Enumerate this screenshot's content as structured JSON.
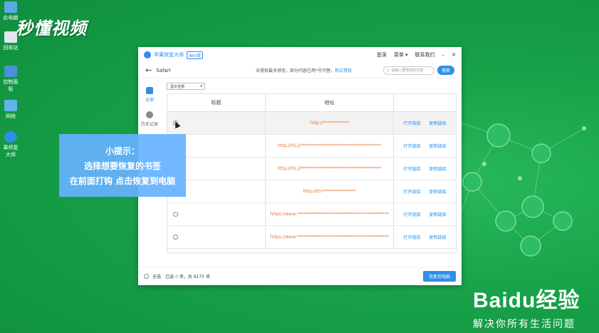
{
  "watermark_top": "秒懂视频",
  "desktop_icons": [
    {
      "label": "此电脑",
      "color": "#5aa9e6"
    },
    {
      "label": "回收站",
      "color": "#dfe8ef"
    },
    {
      "label": "控制面板",
      "color": "#4a90d9"
    },
    {
      "label": "网络",
      "color": "#62b3e8"
    },
    {
      "label": "果师复大师",
      "color": "#2f8fe8"
    }
  ],
  "window": {
    "app_title": "苹果恢复大师",
    "version_badge": "Win版",
    "login": "登录",
    "menu": "菜单 ▾",
    "contact": "联系我们",
    "minimize": "–",
    "close": "✕",
    "nav_title": "Safari",
    "notice": "未授权最多预览，部分内容已用*号代替，",
    "notice_link": "购买授权",
    "search_placeholder": "请输入要查找的内容",
    "search_button": "搜索",
    "sidebar": [
      {
        "label": "全部",
        "active": true
      },
      {
        "label": "历史记录",
        "active": false
      }
    ],
    "filter": "显示全部",
    "columns": {
      "title": "标题",
      "url": "地址"
    },
    "rows": [
      {
        "url": "http://************",
        "open": "打开链接",
        "copy": "复制链接"
      },
      {
        "url": "http://h5.ji**************************************",
        "open": "打开链接",
        "copy": "复制链接"
      },
      {
        "url": "http://h5.ji**************************************",
        "open": "打开链接",
        "copy": "复制链接"
      },
      {
        "url": "http://h5****************",
        "open": "打开链接",
        "copy": "复制链接"
      },
      {
        "url": "https://www.*******************************************",
        "open": "打开链接",
        "copy": "复制链接"
      },
      {
        "url": "https://www.*******************************************",
        "open": "打开链接",
        "copy": "复制链接"
      }
    ],
    "footer": {
      "select_all": "全选",
      "selected_prefix": "已选",
      "selected_count": "0",
      "selected_suffix": "项，共 9175 项",
      "restore_button": "恢复到电脑"
    }
  },
  "tip": {
    "line1": "小提示：",
    "line2": "选择想要恢复的书签",
    "line3": "在前面打钩  点击恢复到电脑"
  },
  "baidu": {
    "logo": "Baidu经验",
    "slogan": "解决你所有生活问题"
  }
}
